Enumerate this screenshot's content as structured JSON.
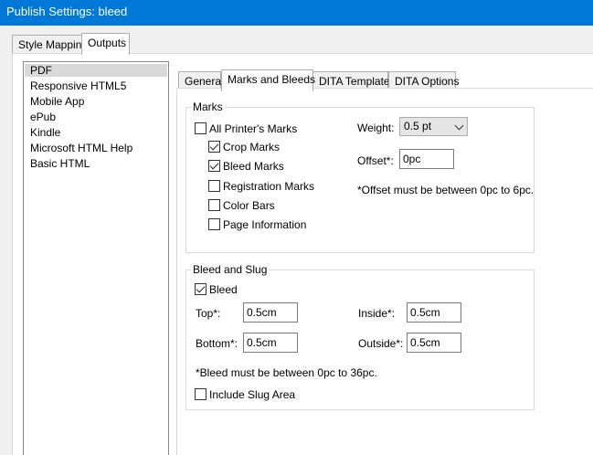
{
  "window": {
    "title": "Publish Settings: bleed"
  },
  "top_tabs": [
    {
      "label": "Style Mapping"
    },
    {
      "label": "Outputs"
    }
  ],
  "outputs": [
    {
      "label": "PDF"
    },
    {
      "label": "Responsive HTML5"
    },
    {
      "label": "Mobile App"
    },
    {
      "label": "ePub"
    },
    {
      "label": "Kindle"
    },
    {
      "label": "Microsoft HTML Help"
    },
    {
      "label": "Basic HTML"
    }
  ],
  "inner_tabs": [
    {
      "label": "General"
    },
    {
      "label": "Marks and Bleeds"
    },
    {
      "label": "DITA Template"
    },
    {
      "label": "DITA Options"
    }
  ],
  "marks": {
    "group_label": "Marks",
    "all_printers_marks": {
      "label": "All Printer's Marks",
      "checked": false
    },
    "crop_marks": {
      "label": "Crop Marks",
      "checked": true
    },
    "bleed_marks": {
      "label": "Bleed Marks",
      "checked": true
    },
    "registration_marks": {
      "label": "Registration Marks",
      "checked": false
    },
    "color_bars": {
      "label": "Color Bars",
      "checked": false
    },
    "page_information": {
      "label": "Page Information",
      "checked": false
    },
    "weight_label": "Weight:",
    "weight_value": "0.5 pt",
    "offset_label": "Offset*:",
    "offset_value": "0pc",
    "offset_note": "*Offset must be between 0pc to 6pc."
  },
  "bleed_slug": {
    "group_label": "Bleed and Slug",
    "bleed": {
      "label": "Bleed",
      "checked": true
    },
    "top_label": "Top*:",
    "top_value": "0.5cm",
    "bottom_label": "Bottom*:",
    "bottom_value": "0.5cm",
    "inside_label": "Inside*:",
    "inside_value": "0.5cm",
    "outside_label": "Outside*:",
    "outside_value": "0.5cm",
    "note": "*Bleed must be between 0pc to 36pc.",
    "include_slug": {
      "label": "Include Slug Area",
      "checked": false
    }
  }
}
